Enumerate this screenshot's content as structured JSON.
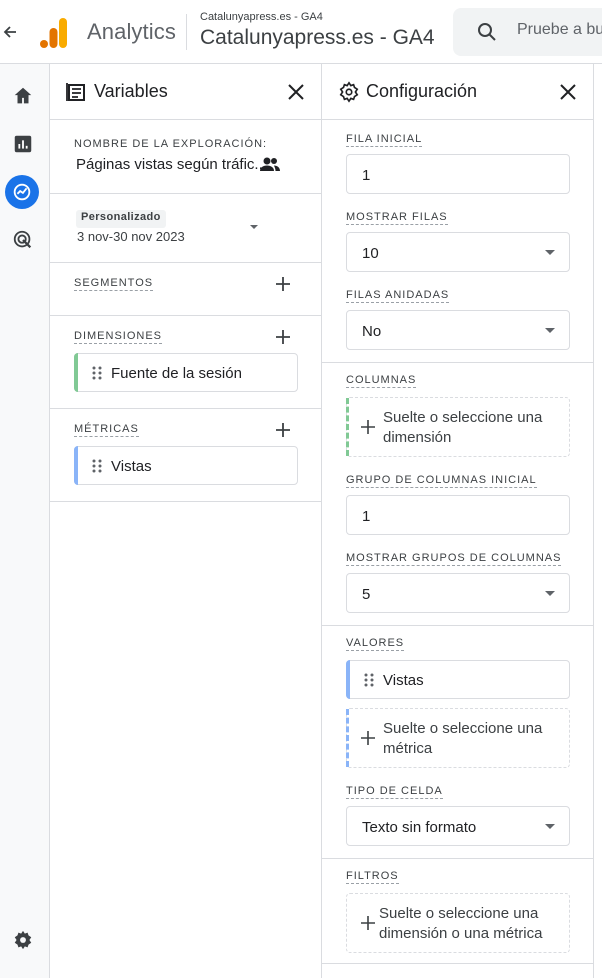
{
  "header": {
    "app_name": "Analytics",
    "account_small": "Catalunyapress.es - GA4",
    "account_big": "Catalunyapress.es - GA4",
    "search_placeholder": "Pruebe a bu",
    "brand_colors": {
      "logo_dark": "#E37400",
      "logo_light": "#F9AB00"
    }
  },
  "rail": {
    "items": [
      {
        "icon": "home-icon"
      },
      {
        "icon": "reports-icon"
      },
      {
        "icon": "explore-icon",
        "active": true
      },
      {
        "icon": "advertising-icon"
      }
    ],
    "bottom_icon": "settings-icon",
    "active_color": "#1a73e8"
  },
  "variables": {
    "title": "Variables",
    "exploration_name_label": "NOMBRE DE LA EXPLORACIÓN:",
    "exploration_name": "Páginas vistas según tráfic...",
    "date_badge": "Personalizado",
    "date_range": "3 nov-30 nov 2023",
    "segments_label": "SEGMENTOS",
    "dimensions_label": "DIMENSIONES",
    "dimensions": [
      {
        "label": "Fuente de la sesión",
        "color": "#81c995"
      }
    ],
    "metrics_label": "MÉTRICAS",
    "metrics": [
      {
        "label": "Vistas",
        "color": "#8ab4f8"
      }
    ]
  },
  "config": {
    "title": "Configuración",
    "start_row_label": "FILA INICIAL",
    "start_row": "1",
    "show_rows_label": "MOSTRAR FILAS",
    "show_rows": "10",
    "nested_rows_label": "FILAS ANIDADAS",
    "nested_rows": "No",
    "columns_label": "COLUMNAS",
    "columns_drop": "Suelte o seleccione una dimensión",
    "start_col_group_label": "GRUPO DE COLUMNAS INICIAL",
    "start_col_group": "1",
    "show_col_groups_label": "MOSTRAR GRUPOS DE COLUMNAS",
    "show_col_groups": "5",
    "values_label": "VALORES",
    "values_chip": "Vistas",
    "values_drop": "Suelte o seleccione una métrica",
    "cell_type_label": "TIPO DE CELDA",
    "cell_type": "Texto sin formato",
    "filters_label": "FILTROS",
    "filters_drop": "Suelte o seleccione una dimensión o una métrica",
    "dimension_accent": "#81c995",
    "metric_accent": "#8ab4f8"
  }
}
